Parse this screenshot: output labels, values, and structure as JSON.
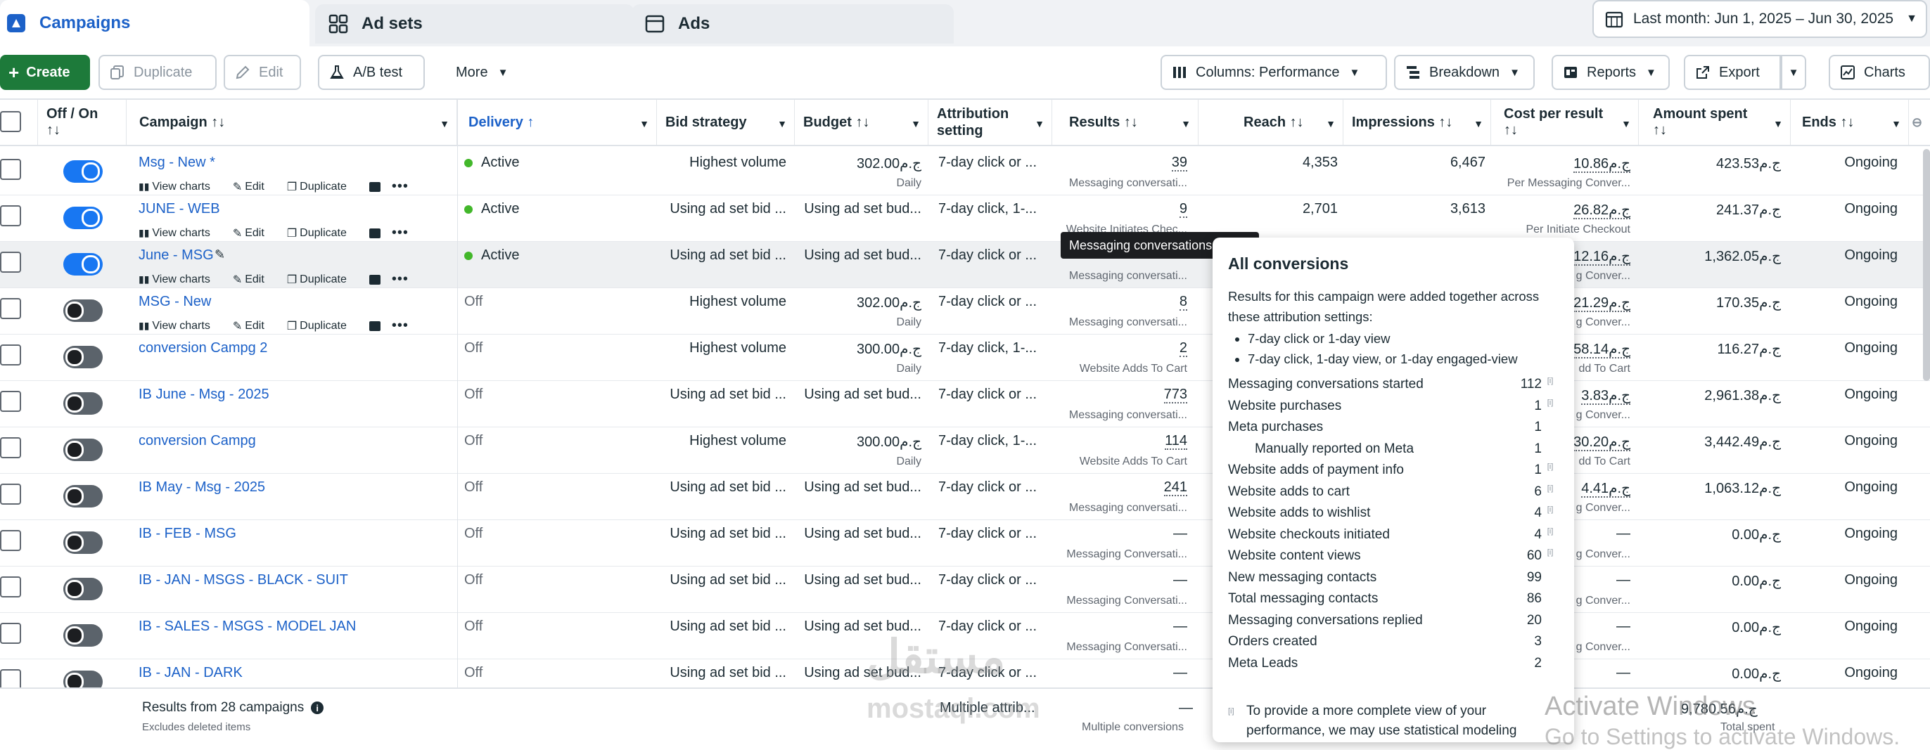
{
  "tabs": [
    {
      "label": "Campaigns",
      "icon": "campaign-icon",
      "active": true
    },
    {
      "label": "Ad sets",
      "icon": "adsets-icon",
      "active": false
    },
    {
      "label": "Ads",
      "icon": "ads-icon",
      "active": false
    }
  ],
  "date_range": "Last month: Jun 1, 2025 – Jun 30, 2025",
  "toolbar": {
    "create": "Create",
    "duplicate": "Duplicate",
    "edit": "Edit",
    "ab_test": "A/B test",
    "more": "More",
    "columns": "Columns: Performance",
    "breakdown": "Breakdown",
    "reports": "Reports",
    "export": "Export",
    "charts": "Charts"
  },
  "columns": {
    "offon": "Off / On",
    "campaign": "Campaign",
    "delivery": "Delivery",
    "bid": "Bid strategy",
    "budget": "Budget",
    "attribution": "Attribution setting",
    "results": "Results",
    "reach": "Reach",
    "impressions": "Impressions",
    "cpr": "Cost per result",
    "spent": "Amount spent",
    "ends": "Ends"
  },
  "row_actions": {
    "view_charts": "View charts",
    "edit": "Edit",
    "duplicate": "Duplicate"
  },
  "rows": [
    {
      "name": "Msg - New *",
      "on": true,
      "delivery": "Active",
      "bid": "Highest volume",
      "budget": "302.00ج.م",
      "budget_sub": "Daily",
      "attr": "7-day click or ...",
      "results": "39",
      "results_sub": "Messaging conversati...",
      "reach": "4,353",
      "impr": "6,467",
      "cpr": "10.86ج.م",
      "cpr_sub": "Per Messaging Conver...",
      "spent": "423.53ج.م",
      "ends": "Ongoing",
      "actions": true
    },
    {
      "name": "JUNE - WEB",
      "on": true,
      "delivery": "Active",
      "bid": "Using ad set bid ...",
      "budget": "Using ad set bud...",
      "budget_sub": "",
      "attr": "7-day click, 1-...",
      "results": "9",
      "results_sub": "Website Initiates Chec...",
      "reach": "2,701",
      "impr": "3,613",
      "cpr": "26.82ج.م",
      "cpr_sub": "Per Initiate Checkout",
      "spent": "241.37ج.م",
      "ends": "Ongoing",
      "actions": true
    },
    {
      "name": "June - MSG",
      "on": true,
      "delivery": "Active",
      "bid": "Using ad set bid ...",
      "budget": "Using ad set bud...",
      "budget_sub": "",
      "attr": "7-day click or ...",
      "results": "",
      "results_sub": "Messaging conversati...",
      "reach": "",
      "impr": "",
      "cpr": "12.16ج.م",
      "cpr_sub": "g Conver...",
      "spent": "1,362.05ج.م",
      "ends": "Ongoing",
      "actions": true
    },
    {
      "name": "MSG - New",
      "on": false,
      "delivery": "Off",
      "bid": "Highest volume",
      "budget": "302.00ج.م",
      "budget_sub": "Daily",
      "attr": "7-day click or ...",
      "results": "8",
      "results_sub": "Messaging conversati...",
      "reach": "",
      "impr": "",
      "cpr": "21.29ج.م",
      "cpr_sub": "g Conver...",
      "spent": "170.35ج.م",
      "ends": "Ongoing",
      "actions": true
    },
    {
      "name": "conversion Campg 2",
      "on": false,
      "delivery": "Off",
      "bid": "Highest volume",
      "budget": "300.00ج.م",
      "budget_sub": "Daily",
      "attr": "7-day click, 1-...",
      "results": "2",
      "results_sub": "Website Adds To Cart",
      "reach": "",
      "impr": "",
      "cpr": "58.14ج.م",
      "cpr_sub": "dd To Cart",
      "spent": "116.27ج.م",
      "ends": "Ongoing",
      "actions": false
    },
    {
      "name": "IB June - Msg - 2025",
      "on": false,
      "delivery": "Off",
      "bid": "Using ad set bid ...",
      "budget": "Using ad set bud...",
      "budget_sub": "",
      "attr": "7-day click or ...",
      "results": "773",
      "results_sub": "Messaging conversati...",
      "reach": "",
      "impr": "",
      "cpr": "3.83ج.م",
      "cpr_sub": "g Conver...",
      "spent": "2,961.38ج.م",
      "ends": "Ongoing",
      "actions": false
    },
    {
      "name": "conversion Campg",
      "on": false,
      "delivery": "Off",
      "bid": "Highest volume",
      "budget": "300.00ج.م",
      "budget_sub": "Daily",
      "attr": "7-day click, 1-...",
      "results": "114",
      "results_sub": "Website Adds To Cart",
      "reach": "",
      "impr": "",
      "cpr": "30.20ج.م",
      "cpr_sub": "dd To Cart",
      "spent": "3,442.49ج.م",
      "ends": "Ongoing",
      "actions": false
    },
    {
      "name": "IB May - Msg - 2025",
      "on": false,
      "delivery": "Off",
      "bid": "Using ad set bid ...",
      "budget": "Using ad set bud...",
      "budget_sub": "",
      "attr": "7-day click or ...",
      "results": "241",
      "results_sub": "Messaging conversati...",
      "reach": "",
      "impr": "",
      "cpr": "4.41ج.م",
      "cpr_sub": "g Conver...",
      "spent": "1,063.12ج.م",
      "ends": "Ongoing",
      "actions": false
    },
    {
      "name": "IB - FEB - MSG",
      "on": false,
      "delivery": "Off",
      "bid": "Using ad set bid ...",
      "budget": "Using ad set bud...",
      "budget_sub": "",
      "attr": "7-day click or ...",
      "results": "—",
      "results_sub": "Messaging Conversati...",
      "reach": "",
      "impr": "",
      "cpr": "—",
      "cpr_sub": "g Conver...",
      "spent": "0.00ج.م",
      "ends": "Ongoing",
      "actions": false
    },
    {
      "name": "IB - JAN - MSGS - BLACK - SUIT",
      "on": false,
      "delivery": "Off",
      "bid": "Using ad set bid ...",
      "budget": "Using ad set bud...",
      "budget_sub": "",
      "attr": "7-day click or ...",
      "results": "—",
      "results_sub": "Messaging Conversati...",
      "reach": "",
      "impr": "",
      "cpr": "—",
      "cpr_sub": "g Conver...",
      "spent": "0.00ج.م",
      "ends": "Ongoing",
      "actions": false
    },
    {
      "name": "IB - SALES - MSGS - MODEL JAN",
      "on": false,
      "delivery": "Off",
      "bid": "Using ad set bid ...",
      "budget": "Using ad set bud...",
      "budget_sub": "",
      "attr": "7-day click or ...",
      "results": "—",
      "results_sub": "Messaging Conversati...",
      "reach": "",
      "impr": "",
      "cpr": "—",
      "cpr_sub": "g Conver...",
      "spent": "0.00ج.م",
      "ends": "Ongoing",
      "actions": false
    },
    {
      "name": "IB - JAN - DARK",
      "on": false,
      "delivery": "Off",
      "bid": "Using ad set bid ...",
      "budget": "Using ad set bud...",
      "budget_sub": "",
      "attr": "7-day click or ...",
      "results": "—",
      "results_sub": "",
      "reach": "",
      "impr": "",
      "cpr": "—",
      "cpr_sub": "",
      "spent": "0.00ج.م",
      "ends": "Ongoing",
      "actions": false
    }
  ],
  "footer": {
    "summary": "Results from 28 campaigns",
    "excluded": "Excludes deleted items",
    "attr": "Multiple attrib...",
    "results": "—",
    "results_sub": "Multiple conversions",
    "spent": "9,780.56ج.م",
    "spent_sub": "Total spent"
  },
  "tooltip_dark": "Messaging conversations",
  "popover": {
    "title": "All conversions",
    "desc": "Results for this campaign were added together across these attribution settings:",
    "bullets": [
      "7-day click or 1-day view",
      "7-day click, 1-day view, or 1-day engaged-view"
    ],
    "lines": [
      {
        "label": "Messaging conversations started",
        "value": "112",
        "info": true,
        "indent": false
      },
      {
        "label": "Website purchases",
        "value": "1",
        "info": true,
        "indent": false
      },
      {
        "label": "Meta purchases",
        "value": "1",
        "info": false,
        "indent": false
      },
      {
        "label": "Manually reported on Meta",
        "value": "1",
        "info": false,
        "indent": true
      },
      {
        "label": "Website adds of payment info",
        "value": "1",
        "info": true,
        "indent": false
      },
      {
        "label": "Website adds to cart",
        "value": "6",
        "info": true,
        "indent": false
      },
      {
        "label": "Website adds to wishlist",
        "value": "4",
        "info": true,
        "indent": false
      },
      {
        "label": "Website checkouts initiated",
        "value": "4",
        "info": true,
        "indent": false
      },
      {
        "label": "Website content views",
        "value": "60",
        "info": true,
        "indent": false
      },
      {
        "label": "New messaging contacts",
        "value": "99",
        "info": false,
        "indent": false
      },
      {
        "label": "Total messaging contacts",
        "value": "86",
        "info": false,
        "indent": false
      },
      {
        "label": "Messaging conversations replied",
        "value": "20",
        "info": false,
        "indent": false
      },
      {
        "label": "Orders created",
        "value": "3",
        "info": false,
        "indent": false
      },
      {
        "label": "Meta Leads",
        "value": "2",
        "info": false,
        "indent": false
      }
    ],
    "note": "To provide a more complete view of your performance, we may use statistical modeling"
  },
  "watermark": {
    "line1": "Activate Windows",
    "line2": "Go to Settings to activate Windows.",
    "logo": "مستقل",
    "logo_sub": "mostaql.com"
  },
  "colors": {
    "accent": "#1877f2",
    "link": "#1c61c8",
    "create": "#1d7a3a",
    "active_dot": "#42b72a"
  }
}
